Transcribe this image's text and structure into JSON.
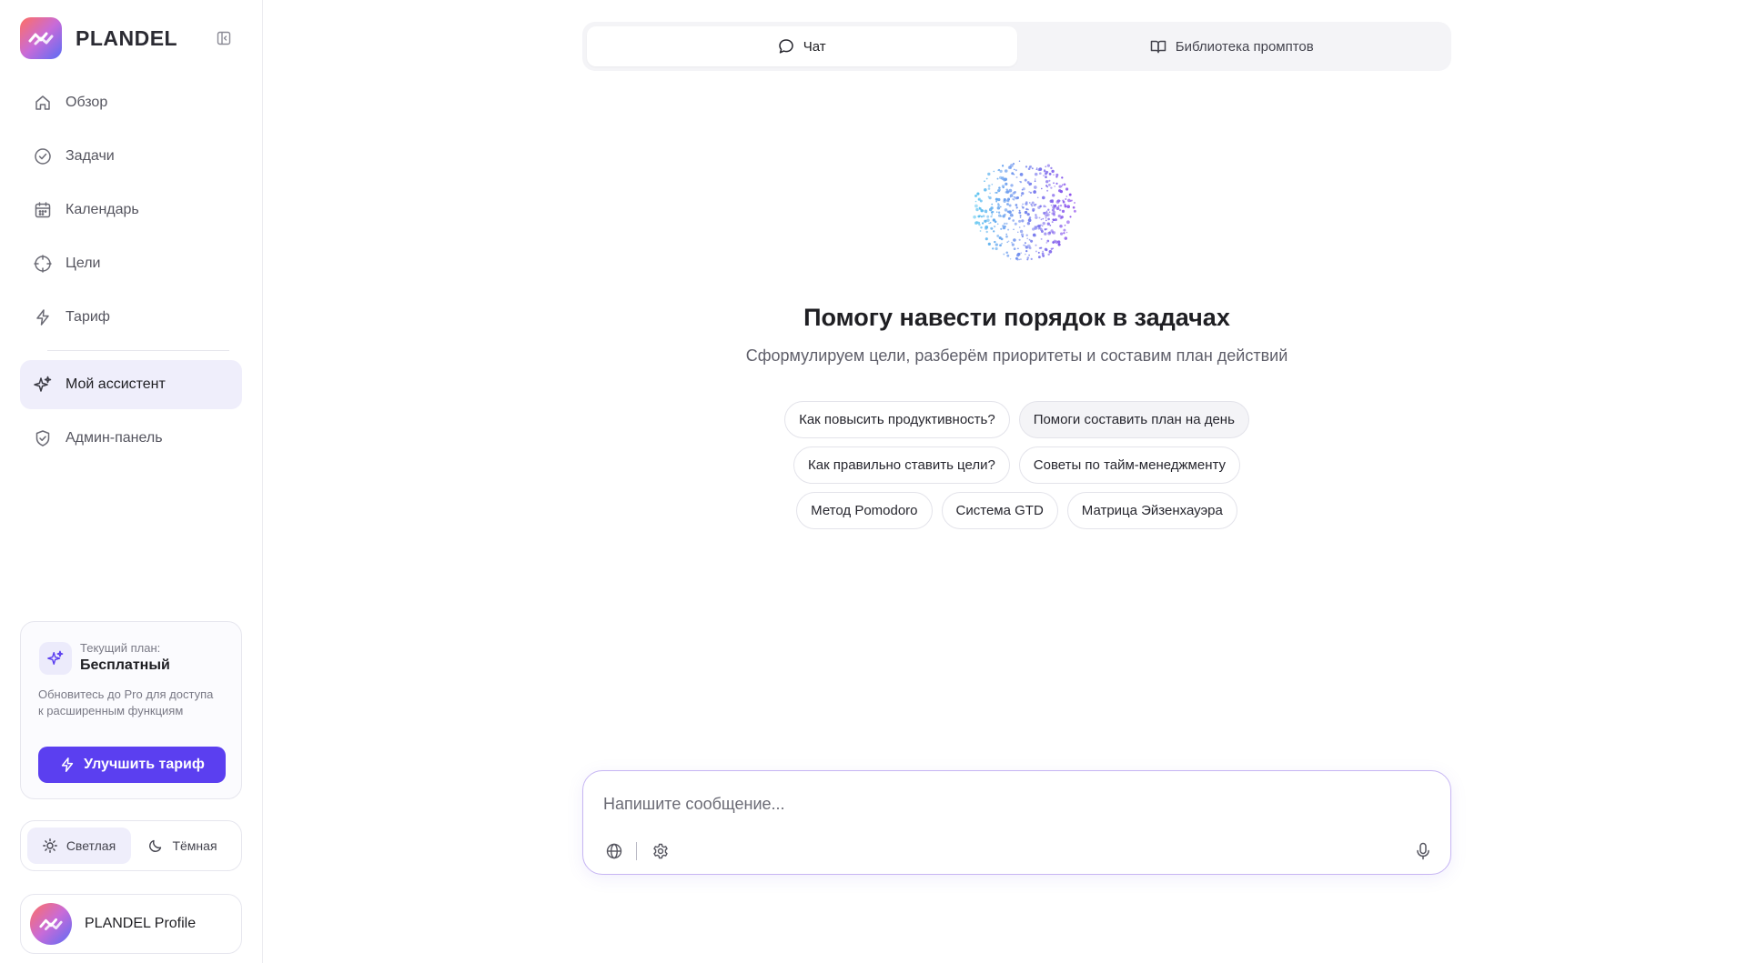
{
  "brand": {
    "name": "PLANDEL"
  },
  "sidebar": {
    "items": [
      {
        "label": "Обзор",
        "icon": "home-icon"
      },
      {
        "label": "Задачи",
        "icon": "check-circle-icon"
      },
      {
        "label": "Календарь",
        "icon": "calendar-icon"
      },
      {
        "label": "Цели",
        "icon": "target-icon"
      },
      {
        "label": "Тариф",
        "icon": "lightning-icon"
      }
    ],
    "lower_items": [
      {
        "label": "Мой ассистент",
        "icon": "sparkles-icon",
        "active": true
      },
      {
        "label": "Админ-панель",
        "icon": "shield-icon"
      }
    ]
  },
  "plan": {
    "caption": "Текущий план:",
    "name": "Бесплатный",
    "description": "Обновитесь до Pro для доступа к расширенным функциям",
    "upgrade_label": "Улучшить тариф"
  },
  "theme": {
    "light_label": "Светлая",
    "dark_label": "Тёмная",
    "selected": "light"
  },
  "profile": {
    "name": "PLANDEL Profile"
  },
  "tabs": [
    {
      "label": "Чат",
      "icon": "chat-bubble-icon",
      "active": true
    },
    {
      "label": "Библиотека промптов",
      "icon": "book-open-icon",
      "active": false
    }
  ],
  "hero": {
    "title": "Помогу навести порядок в задачах",
    "subtitle": "Сформулируем цели, разберём приоритеты и составим план действий"
  },
  "suggestions": [
    [
      "Как повысить продуктивность?",
      "Помоги составить план на день"
    ],
    [
      "Как правильно ставить цели?",
      "Советы по тайм-менеджменту"
    ],
    [
      "Метод Pomodoro",
      "Система GTD",
      "Матрица Эйзенхауэра"
    ]
  ],
  "composer": {
    "placeholder": "Напишите сообщение...",
    "value": ""
  },
  "colors": {
    "accent": "#5b3ff0",
    "active_bg": "#efeefb",
    "composer_border": "#c6b5f3"
  }
}
